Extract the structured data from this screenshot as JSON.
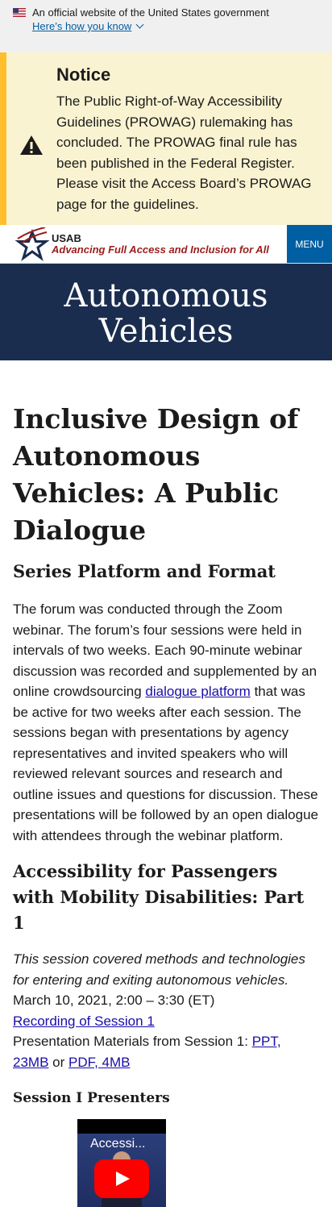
{
  "gov_banner": {
    "text": "An official website of the United States government",
    "link": "Here’s how you know"
  },
  "notice": {
    "title": "Notice",
    "body": "The Public Right-of-Way Accessibility Guidelines (PROWAG) rulemaking has concluded. The PROWAG final rule has been published in the Federal Register. Please visit the Access Board’s PROWAG page for the guidelines."
  },
  "header": {
    "logo_abbr": "USAB",
    "logo_tagline": "Advancing Full Access and Inclusion for All",
    "menu_label": "MENU"
  },
  "hero": {
    "line1": "Autonomous",
    "line2": "Vehicles"
  },
  "main": {
    "title": "Inclusive Design of Autonomous Vehicles: A Public Dialogue",
    "section_heading": "Series Platform and Format",
    "paragraph_pre": "The forum was conducted through the Zoom webinar.  The forum’s four sessions were held in intervals of two weeks.  Each 90-minute webinar discussion was recorded and supplemented by an online crowdsourcing ",
    "paragraph_link": "dialogue platform",
    "paragraph_post": " that was be active for two weeks after each session.  The sessions began with presentations by agency representatives and invited speakers who will reviewed relevant sources and research and outline issues and questions for discussion.  These presentations will be followed by an open dialogue with attendees through the webinar platform.",
    "session1": {
      "heading": "Accessibility for Passengers with Mobility Disabilities:  Part 1",
      "description": "This session covered methods and technologies for entering and exiting autonomous vehicles.",
      "date": "March 10, 2021, 2:00 – 3:30 (ET)",
      "recording_link": "Recording of Session 1",
      "materials_prefix": "Presentation Materials from Session 1: ",
      "ppt_link": "PPT, 23MB",
      "or_text": " or",
      "pdf_link": "PDF, 4MB",
      "presenters_heading": "Session I Presenters",
      "video_title": "Accessi..."
    }
  },
  "colors": {
    "banner_bg": "#f0f0f0",
    "notice_bg": "#faf3d1",
    "notice_border": "#ffbe2e",
    "menu_bg": "#005ea2",
    "hero_bg": "#1a2d4f",
    "tagline": "#9b1c1c",
    "link": "#1a0dab"
  },
  "icons": [
    "us-flag-icon",
    "chevron-down-icon",
    "warning-icon",
    "usab-star-logo",
    "play-icon"
  ]
}
